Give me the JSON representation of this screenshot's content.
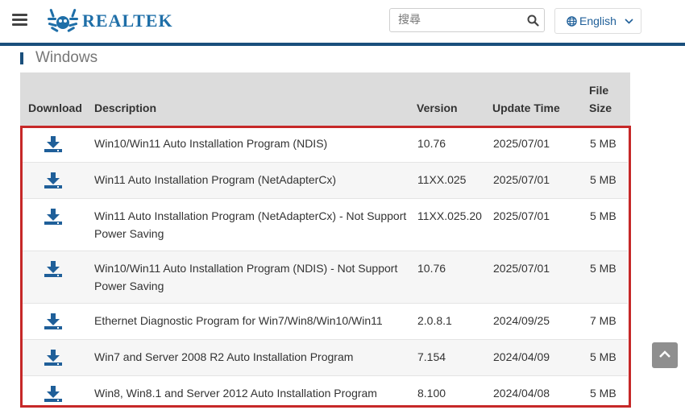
{
  "header": {
    "brand": "REALTEK",
    "search": {
      "placeholder": "搜尋",
      "value": ""
    },
    "language": "English"
  },
  "section": {
    "title": "Windows"
  },
  "table": {
    "columns": [
      "Download",
      "Description",
      "Version",
      "Update Time",
      "File",
      "Size"
    ],
    "rows": [
      {
        "description": [
          "Win10/Win11 Auto Installation Program (NDIS)"
        ],
        "version": "10.76",
        "update_time": "2025/07/01",
        "size": "5 MB"
      },
      {
        "description": [
          "Win11 Auto Installation Program (NetAdapterCx)"
        ],
        "version": "11XX.025",
        "update_time": "2025/07/01",
        "size": "5 MB"
      },
      {
        "description": [
          "Win11 Auto Installation Program (NetAdapterCx) - Not Support",
          "Power Saving"
        ],
        "version": "11XX.025.20",
        "update_time": "2025/07/01",
        "size": "5 MB"
      },
      {
        "description": [
          "Win10/Win11 Auto Installation Program (NDIS) - Not Support",
          "Power Saving"
        ],
        "version": "10.76",
        "update_time": "2025/07/01",
        "size": "5 MB"
      },
      {
        "description": [
          "Ethernet Diagnostic Program for Win7/Win8/Win10/Win11"
        ],
        "version": "2.0.8.1",
        "update_time": "2024/09/25",
        "size": "7 MB"
      },
      {
        "description": [
          "Win7 and Server 2008 R2 Auto Installation Program"
        ],
        "version": "7.154",
        "update_time": "2024/04/09",
        "size": "5 MB"
      },
      {
        "description": [
          "Win8, Win8.1 and Server 2012 Auto Installation Program"
        ],
        "version": "8.100",
        "update_time": "2024/04/08",
        "size": "5 MB"
      }
    ]
  },
  "colors": {
    "brand_blue": "#1f6fa8",
    "header_bar": "#1a4f7c",
    "highlight": "#c62828",
    "download_icon": "#1f5f99"
  },
  "icons": {
    "menu": "hamburger-icon",
    "search": "search-icon",
    "language": "globe-icon",
    "download": "download-icon",
    "scroll": "chevron-up-icon"
  }
}
